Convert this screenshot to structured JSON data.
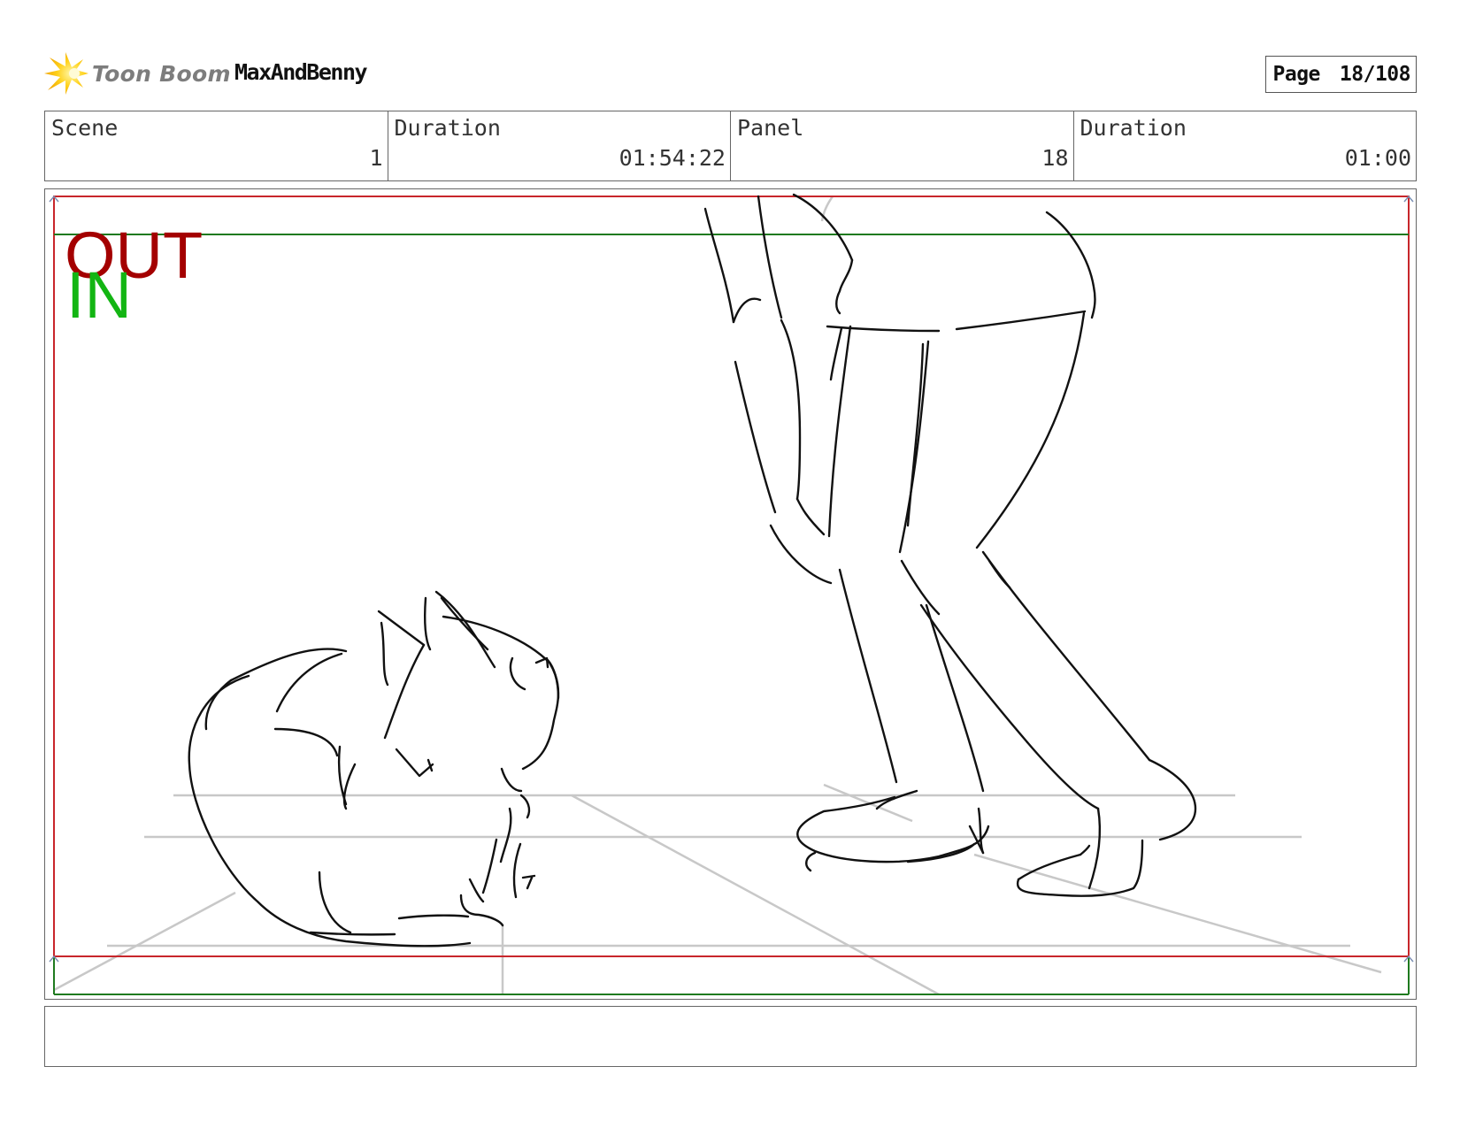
{
  "header": {
    "logo_text": "Toon Boom",
    "logo_icon": "starburst-logo-icon",
    "project_name": "MaxAndBenny",
    "page_label": "Page",
    "page_value": "18/108"
  },
  "info": {
    "scene_label": "Scene",
    "scene_value": "1",
    "scene_duration_label": "Duration",
    "scene_duration_value": "01:54:22",
    "panel_label": "Panel",
    "panel_value": "18",
    "panel_duration_label": "Duration",
    "panel_duration_value": "01:00"
  },
  "panel": {
    "out_label": "OUT",
    "in_label": "IN",
    "colors": {
      "out": "#a40000",
      "in": "#13b513",
      "out_frame": "#c8262b",
      "in_frame": "#1f7a1f",
      "guides": "#c8c8c8",
      "sketch": "#111111"
    }
  },
  "notes": {
    "text": ""
  }
}
